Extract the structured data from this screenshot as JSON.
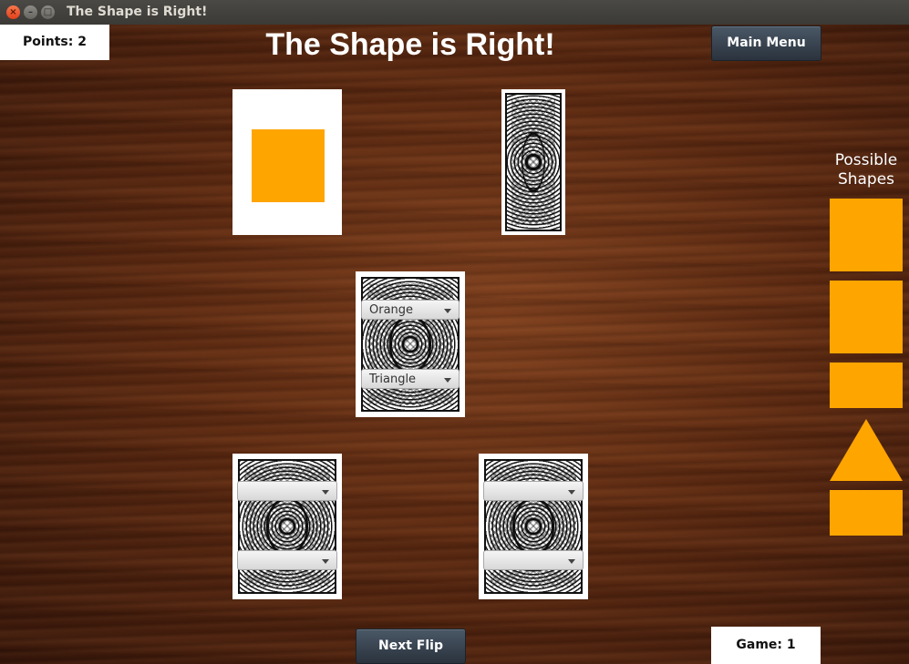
{
  "window": {
    "title": "The Shape is Right!",
    "buttons": [
      "×",
      "–",
      "□"
    ]
  },
  "header": {
    "title": "The Shape is Right!",
    "main_menu_label": "Main Menu"
  },
  "score": {
    "points_text": "Points: 2",
    "game_text": "Game: 1"
  },
  "footer": {
    "next_flip_label": "Next Flip"
  },
  "center_card": {
    "color_value": "Orange",
    "shape_value": "Triangle"
  },
  "bottom_left_card": {
    "color_value": "",
    "shape_value": ""
  },
  "bottom_right_card": {
    "color_value": "",
    "shape_value": ""
  },
  "revealed_card": {
    "color": "#ffa500",
    "shape": "square"
  },
  "sidebar": {
    "title_line1": "Possible",
    "title_line2": "Shapes",
    "shapes": [
      "square",
      "square",
      "rectangle",
      "triangle",
      "rectangle"
    ],
    "shape_color": "#ffa500"
  },
  "colors": {
    "accent": "#ffa500",
    "button": "#2a333d",
    "table": "#5a2810"
  }
}
